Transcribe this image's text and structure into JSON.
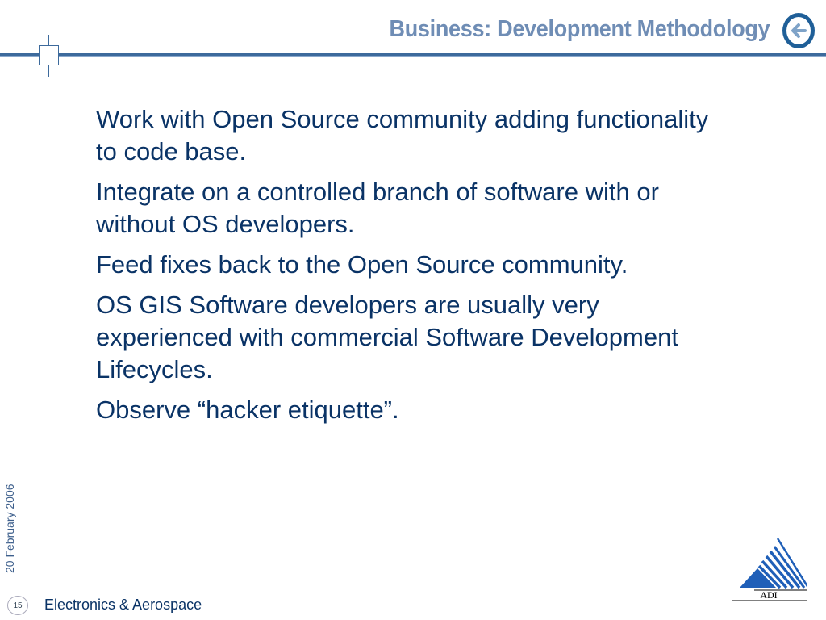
{
  "header": {
    "title": "Business: Development Methodology",
    "back_icon": "back-arrow-circle-icon"
  },
  "content": {
    "bullets": [
      {
        "lines": [
          "Work with Open Source community adding functionality",
          "to code base."
        ]
      },
      {
        "lines": [
          "Integrate on a controlled branch of software with or",
          "without OS developers."
        ]
      },
      {
        "lines": [
          "Feed fixes back to the Open Source community."
        ]
      },
      {
        "lines": [
          "OS GIS Software developers are usually very",
          "experienced with commercial Software Development",
          "Lifecycles."
        ]
      },
      {
        "lines": [
          "Observe “hacker etiquette”."
        ]
      }
    ]
  },
  "footer": {
    "date": "20 February 2006",
    "page_number": "15",
    "division": "Electronics & Aerospace",
    "logo_text": "ADI"
  },
  "colors": {
    "title": "#6f8db5",
    "text": "#0a3366",
    "rule": "#3d6a9c",
    "logo": "#1f5fb8"
  }
}
